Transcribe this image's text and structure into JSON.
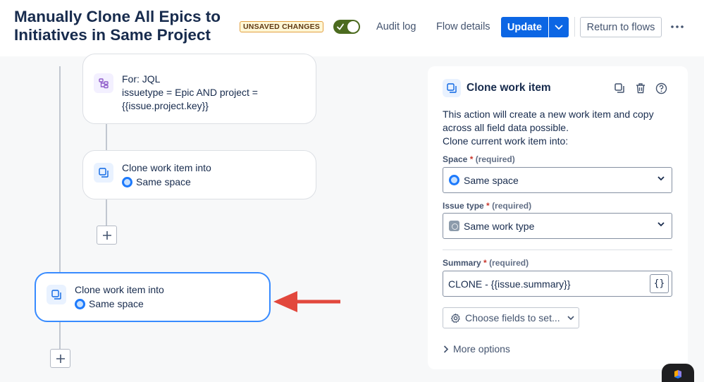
{
  "header": {
    "title": "Manually Clone All Epics to Initiatives in Same Project",
    "badge": "UNSAVED CHANGES",
    "toggle_enabled": true,
    "audit_log": "Audit log",
    "flow_details": "Flow details",
    "update_label": "Update",
    "return_label": "Return to flows",
    "more_icon": "more-horizontal-icon"
  },
  "flow": {
    "for_card": {
      "icon": "branch-icon",
      "title": "For: JQL",
      "line2": "issuetype = Epic AND project =",
      "line3": "{{issue.project.key}}"
    },
    "clone_card_1": {
      "icon": "clone-icon",
      "title": "Clone work item into",
      "space": "Same space"
    },
    "clone_card_2": {
      "icon": "clone-icon",
      "title": "Clone work item into",
      "space": "Same space"
    }
  },
  "panel": {
    "title": "Clone work item",
    "description_1": "This action will create a new work item and copy",
    "description_2": "across all field data possible.",
    "description_3": "Clone current work item into:",
    "space_field": {
      "label": "Space",
      "required_mark": "*",
      "required_text": "(required)",
      "value": "Same space"
    },
    "issue_type_field": {
      "label": "Issue type",
      "required_mark": "*",
      "required_text": "(required)",
      "value": "Same work type"
    },
    "summary_field": {
      "label": "Summary",
      "required_mark": "*",
      "required_text": "(required)",
      "value": "CLONE - {{issue.summary}}",
      "smart_value_button": "{}"
    },
    "choose_fields": "Choose fields to set...",
    "more_options": "More options"
  },
  "colors": {
    "primary": "#0c66e4",
    "selected_border": "#388bff",
    "arrow": "#e2483d",
    "toggle_on": "#4c6b1f",
    "badge_border": "#e2a03f"
  }
}
